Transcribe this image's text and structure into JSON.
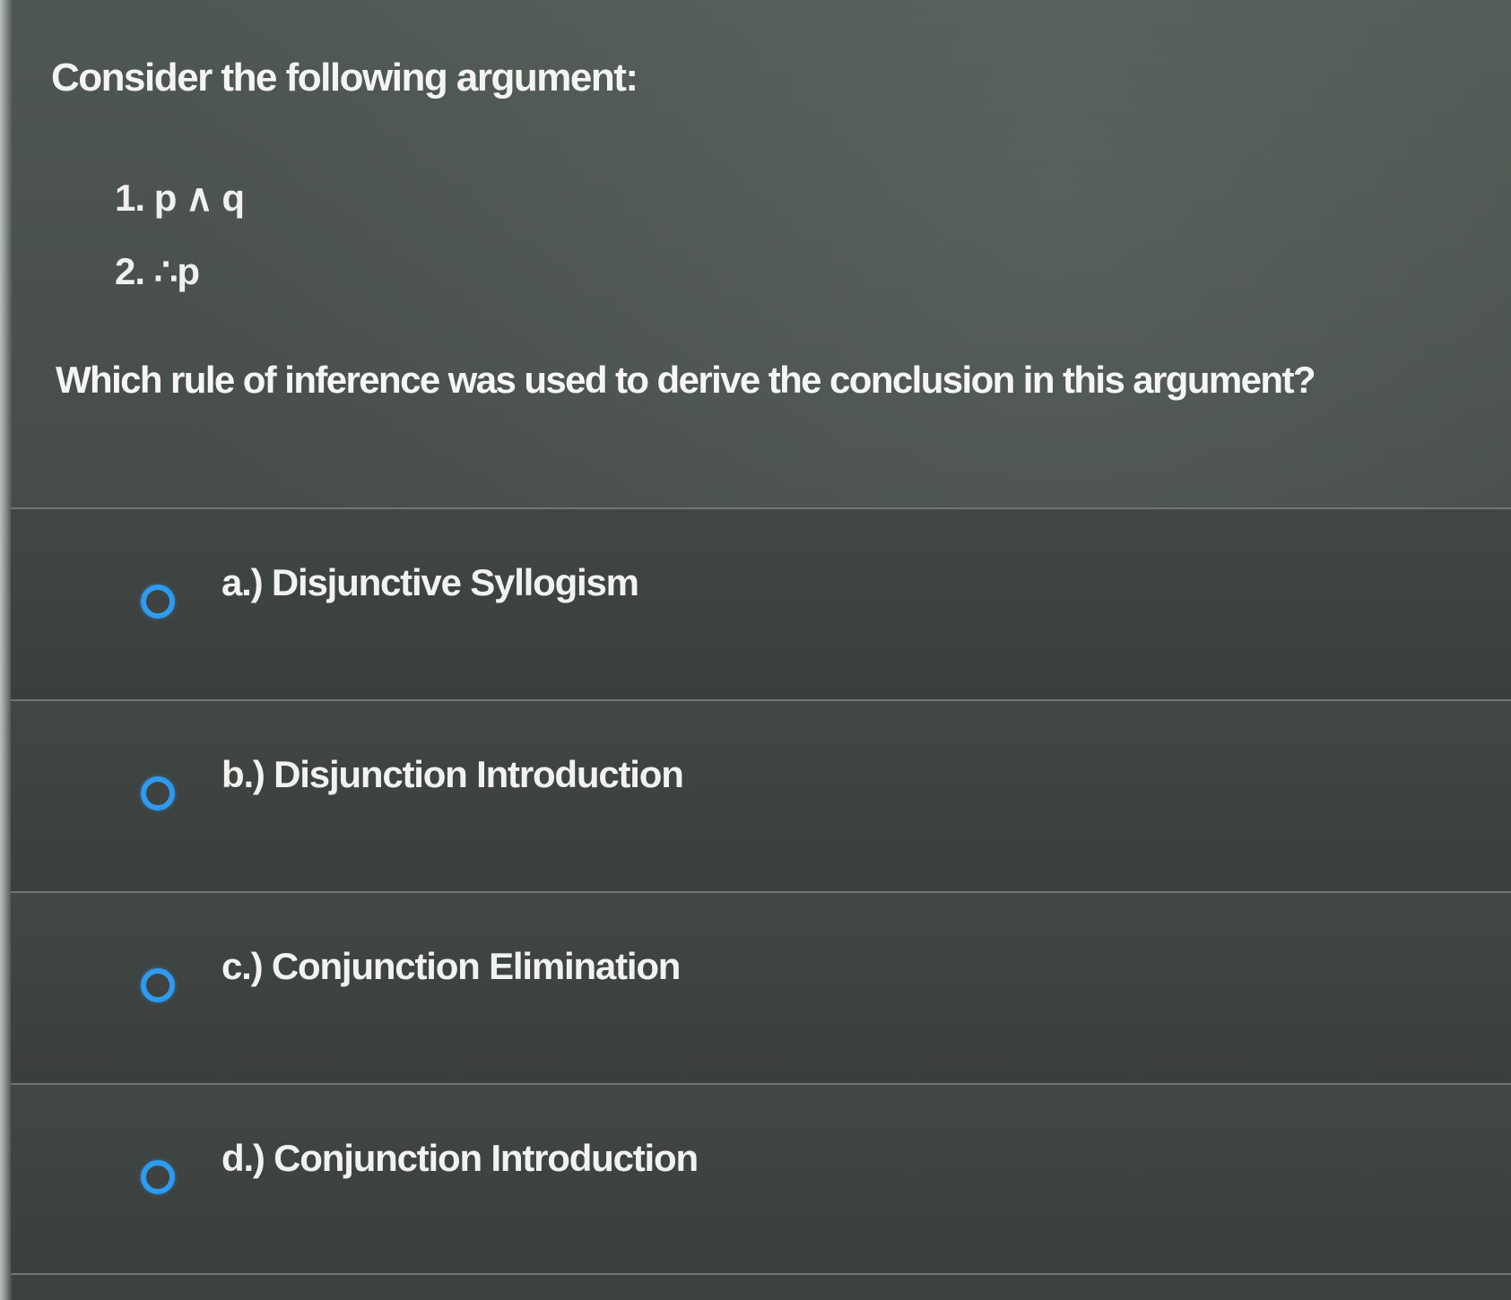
{
  "question": {
    "prompt": "Consider the following argument:",
    "premises": [
      "1. p ∧ q",
      "2. ∴p"
    ],
    "text": "Which rule of inference was used to derive the conclusion in this argument?"
  },
  "options": [
    {
      "label": "a.) Disjunctive Syllogism"
    },
    {
      "label": "b.) Disjunction Introduction"
    },
    {
      "label": "c.) Conjunction Elimination"
    },
    {
      "label": "d.) Conjunction Introduction"
    }
  ],
  "colors": {
    "radio_accent": "#2f9bf0",
    "background": "#3f4442",
    "text": "#f2f3f1"
  }
}
